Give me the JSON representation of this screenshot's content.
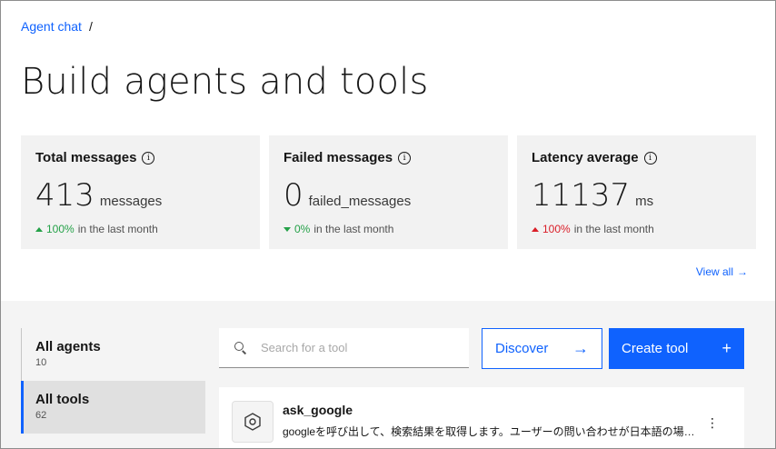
{
  "breadcrumb": {
    "link": "Agent chat",
    "separator": "/"
  },
  "page_title": "Build agents and tools",
  "stats": [
    {
      "title": "Total messages",
      "value": "413",
      "unit": "messages",
      "trend_pct": "100%",
      "trend_text": "in the last month",
      "direction": "up",
      "color": "#24a148"
    },
    {
      "title": "Failed messages",
      "value": "0",
      "unit": "failed_messages",
      "trend_pct": "0%",
      "trend_text": "in the last month",
      "direction": "down",
      "color": "#24a148"
    },
    {
      "title": "Latency average",
      "value": "11137",
      "unit": "ms",
      "trend_pct": "100%",
      "trend_text": "in the last month",
      "direction": "up",
      "color": "#da1e28"
    }
  ],
  "view_all": {
    "label": "View all",
    "arrow": "→"
  },
  "sidenav": [
    {
      "label": "All agents",
      "count": "10"
    },
    {
      "label": "All tools",
      "count": "62"
    }
  ],
  "search": {
    "placeholder": "Search for a tool"
  },
  "buttons": {
    "discover": "Discover",
    "discover_icon": "→",
    "create": "Create tool",
    "create_icon": "+"
  },
  "tool": {
    "name": "ask_google",
    "description": "googleを呼び出して、検索結果を取得します。ユーザーの問い合わせが日本語の場…",
    "overflow_icon": "⋮"
  },
  "colors": {
    "accent": "#0f62fe",
    "positive": "#24a148",
    "negative": "#da1e28"
  }
}
